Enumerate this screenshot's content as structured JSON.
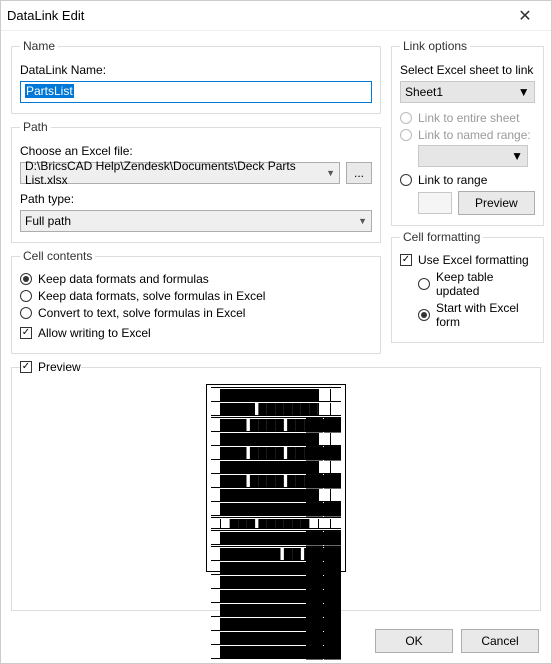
{
  "window": {
    "title": "DataLink Edit"
  },
  "name": {
    "legend": "Name",
    "label": "DataLink Name:",
    "value": "PartsList"
  },
  "path": {
    "legend": "Path",
    "choose_label": "Choose an Excel file:",
    "file_value": "D:\\BricsCAD Help\\Zendesk\\Documents\\Deck Parts List.xlsx",
    "browse": "...",
    "pathtype_label": "Path type:",
    "pathtype_value": "Full path"
  },
  "cell": {
    "legend": "Cell contents",
    "r1": "Keep data formats and formulas",
    "r2": "Keep data formats, solve formulas in Excel",
    "r3": "Convert to text, solve formulas in Excel",
    "allow": "Allow writing to Excel"
  },
  "link": {
    "legend": "Link options",
    "select_label": "Select Excel sheet to link",
    "sheet_value": "Sheet1",
    "entire": "Link to entire sheet",
    "named": "Link to named range:",
    "range": "Link to range",
    "preview": "Preview"
  },
  "fmt": {
    "legend": "Cell formatting",
    "use_excel": "Use Excel formatting",
    "keep": "Keep table updated",
    "start": "Start with Excel form"
  },
  "preview": {
    "legend": "Preview"
  },
  "footer": {
    "ok": "OK",
    "cancel": "Cancel"
  }
}
